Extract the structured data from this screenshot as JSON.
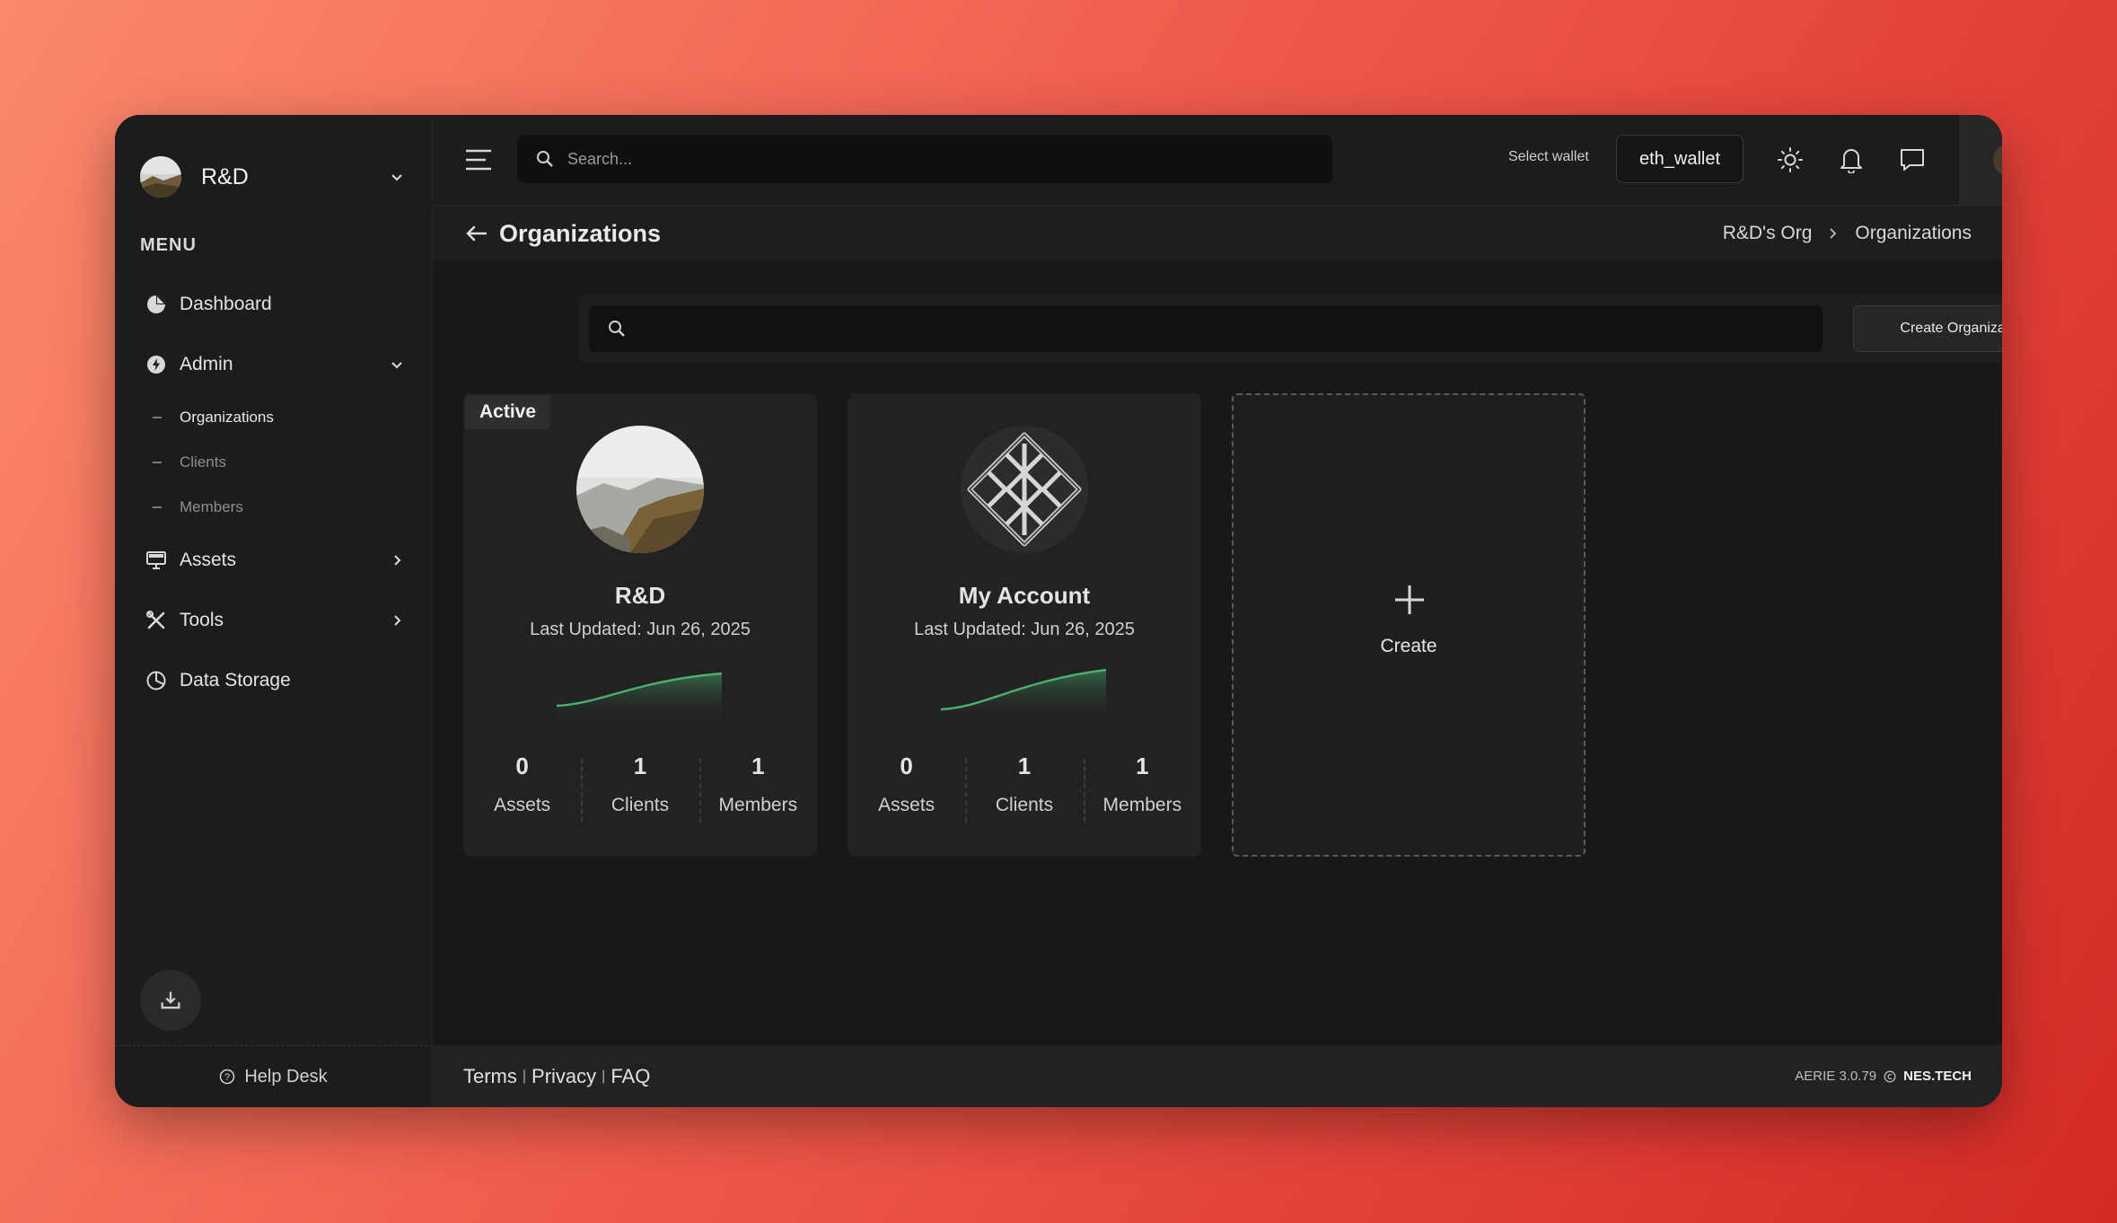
{
  "sidebar": {
    "org_name": "R&D",
    "menu_heading": "MENU",
    "items": [
      {
        "label": "Dashboard"
      },
      {
        "label": "Admin"
      },
      {
        "label": "Assets"
      },
      {
        "label": "Tools"
      },
      {
        "label": "Data Storage"
      }
    ],
    "admin_sub": [
      {
        "label": "Organizations"
      },
      {
        "label": "Clients"
      },
      {
        "label": "Members"
      }
    ],
    "help_desk": "Help Desk"
  },
  "topbar": {
    "search_placeholder": "Search...",
    "wallet_label": "Select wallet",
    "wallet_value": "eth_wallet"
  },
  "page": {
    "title": "Organizations",
    "breadcrumb": [
      "R&D's Org",
      "Organizations"
    ]
  },
  "toolbar": {
    "create_label": "Create Organization"
  },
  "cards": [
    {
      "badge": "Active",
      "title": "R&D",
      "updated": "Last Updated: Jun 26, 2025",
      "stats": [
        {
          "value": "0",
          "label": "Assets"
        },
        {
          "value": "1",
          "label": "Clients"
        },
        {
          "value": "1",
          "label": "Members"
        }
      ]
    },
    {
      "title": "My Account",
      "updated": "Last Updated: Jun 26, 2025",
      "stats": [
        {
          "value": "0",
          "label": "Assets"
        },
        {
          "value": "1",
          "label": "Clients"
        },
        {
          "value": "1",
          "label": "Members"
        }
      ]
    }
  ],
  "create_card": {
    "label": "Create"
  },
  "footer": {
    "links": [
      "Terms",
      "Privacy",
      "FAQ"
    ],
    "version": "AERIE 3.0.79",
    "brand": "NES.TECH"
  },
  "colors": {
    "accent_green": "#4caf6e",
    "background": "#181818",
    "panel": "#1c1c1c"
  }
}
